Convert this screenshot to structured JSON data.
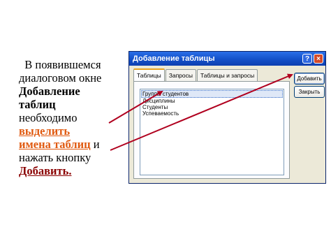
{
  "caption": {
    "line1": "В появившемся",
    "line2": "диалоговом окне",
    "bold1": "Добавление",
    "bold2": "таблиц",
    "line5": "необходимо",
    "orange1": "выделить",
    "orange2": "имена таблиц",
    "line8_tail": " и",
    "line9": "нажать кнопку",
    "red": "Добавить",
    "period": "."
  },
  "dialog": {
    "title": "Добавление таблицы",
    "help_glyph": "?",
    "close_glyph": "×",
    "tabs": [
      {
        "label": "Таблицы",
        "active": true
      },
      {
        "label": "Запросы",
        "active": false
      },
      {
        "label": "Таблицы и запросы",
        "active": false
      }
    ],
    "list_items": [
      "Группы студентов",
      "Дисциплины",
      "Студенты",
      "Успеваемость"
    ],
    "add_button": "Добавить",
    "close_button": "Закрыть"
  },
  "colors": {
    "title_bar": "#1450c8",
    "dialog_bg": "#ece9d8",
    "caption_orange": "#e05a10",
    "caption_red": "#8a0000",
    "arrow": "#b0001e"
  }
}
